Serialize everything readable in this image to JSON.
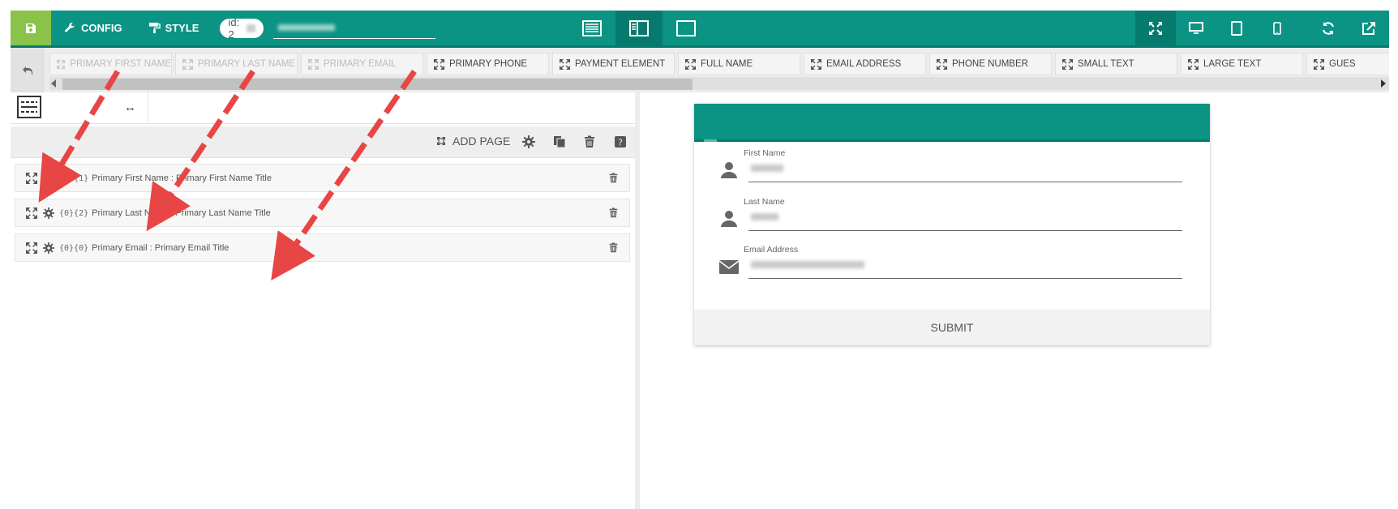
{
  "topbar": {
    "config_label": "CONFIG",
    "style_label": "STYLE",
    "id_prefix": "id: 2",
    "icons": [
      "save-icon",
      "wrench-icon",
      "paint-roller-icon",
      "list-view-icon",
      "split-view-icon",
      "single-view-icon",
      "fullscreen-icon",
      "desktop-icon",
      "tablet-icon",
      "mobile-icon",
      "refresh-icon",
      "external-link-icon"
    ]
  },
  "elements": [
    {
      "label": "PRIMARY FIRST NAME",
      "disabled": true
    },
    {
      "label": "PRIMARY LAST NAME",
      "disabled": true
    },
    {
      "label": "PRIMARY EMAIL",
      "disabled": true
    },
    {
      "label": "PRIMARY PHONE",
      "disabled": false
    },
    {
      "label": "PAYMENT ELEMENT",
      "disabled": false
    },
    {
      "label": "FULL NAME",
      "disabled": false
    },
    {
      "label": "EMAIL ADDRESS",
      "disabled": false
    },
    {
      "label": "PHONE NUMBER",
      "disabled": false
    },
    {
      "label": "SMALL TEXT",
      "disabled": false
    },
    {
      "label": "LARGE TEXT",
      "disabled": false
    },
    {
      "label": "GUES",
      "disabled": false
    }
  ],
  "left": {
    "swap_glyph": "↔",
    "add_page_label": "ADD PAGE",
    "fields": [
      {
        "code": "{0}{1}",
        "text": "Primary First Name : Primary First Name Title"
      },
      {
        "code": "{0}{2}",
        "text": "Primary Last Name : Primary Last Name Title"
      },
      {
        "code": "{0}{0}",
        "text": "Primary Email : Primary Email Title"
      }
    ]
  },
  "form": {
    "fields": [
      {
        "label": "First Name",
        "icon": "user-icon"
      },
      {
        "label": "Last Name",
        "icon": "user-icon"
      },
      {
        "label": "Email Address",
        "icon": "envelope-icon"
      }
    ],
    "submit_label": "SUBMIT"
  },
  "colors": {
    "teal": "#0b9384",
    "teal_dark": "#077a6e",
    "green": "#8bc34a",
    "arrow": "#e84545"
  }
}
